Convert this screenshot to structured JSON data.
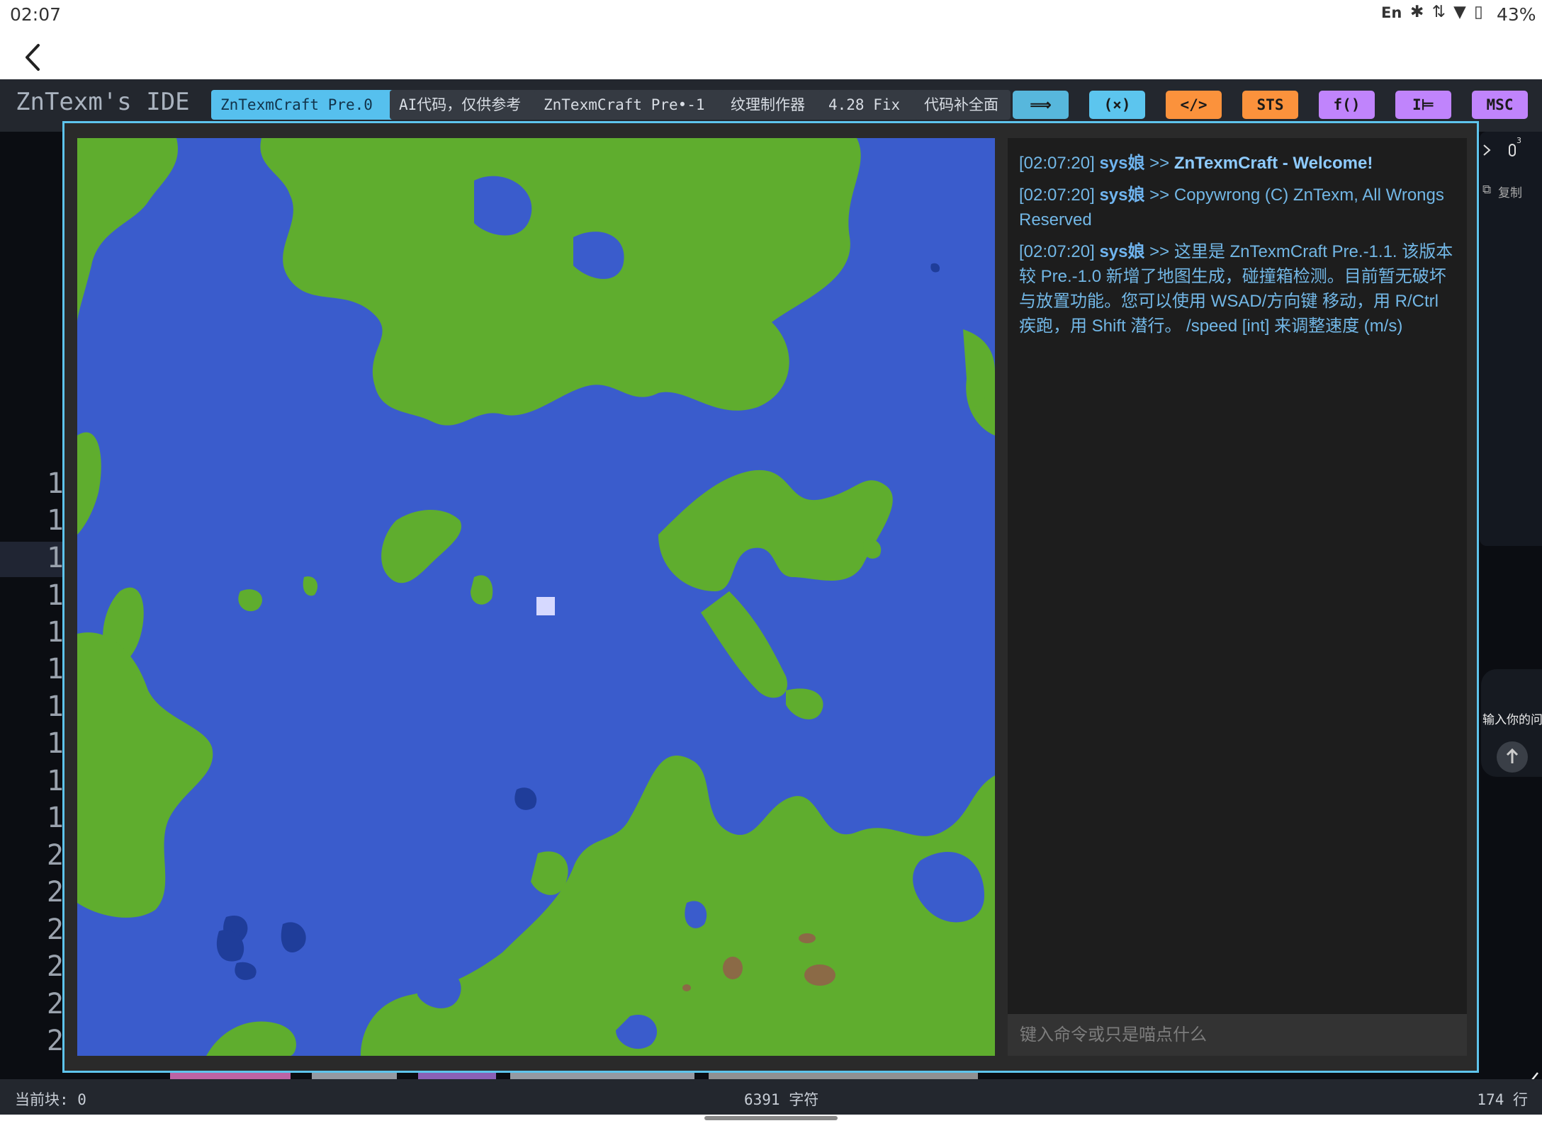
{
  "status_bar": {
    "time": "02:07",
    "lang": "En",
    "icons": "✱ ⇅ ▼ ▯",
    "battery": "43%"
  },
  "ide": {
    "title": "ZnTexm's IDE",
    "tabs": [
      {
        "label": "ZnTexmCraft Pre.0",
        "active": true
      },
      {
        "label": "AI代码，仅供参考",
        "active": false
      },
      {
        "label": "ZnTexmCraft Pre•-1",
        "active": false
      },
      {
        "label": "纹理制作器",
        "active": false
      },
      {
        "label": "4.28 Fix",
        "active": false
      },
      {
        "label": "代码补全面",
        "active": false
      }
    ],
    "tools": [
      {
        "label": "⟹",
        "color": "#57b7dc",
        "icon": "arrow-icon"
      },
      {
        "label": "(×)",
        "color": "#5cc5ee",
        "icon": "variable-icon"
      },
      {
        "label": "</>",
        "color": "#fb923c",
        "icon": "code-icon"
      },
      {
        "label": "STS",
        "color": "#fb923c",
        "icon": "sts-icon"
      },
      {
        "label": "f()",
        "color": "#c084fc",
        "icon": "function-icon"
      },
      {
        "label": "I⊨",
        "color": "#c084fc",
        "icon": "format-icon"
      },
      {
        "label": "MSC",
        "color": "#c084fc",
        "icon": "misc-icon"
      }
    ]
  },
  "editor": {
    "line_numbers": [
      "1",
      "1",
      "1",
      "1",
      "1",
      "1",
      "1",
      "1",
      "1",
      "1",
      "2",
      "2",
      "2",
      "2",
      "2",
      "2"
    ]
  },
  "ai_panel": {
    "copy_label": "复制",
    "input_placeholder": "输入你的问",
    "badge": "3"
  },
  "game": {
    "player_color": "#d6d9ff",
    "colors": {
      "water": "#3a5ccc",
      "deep_water": "#1f3d9a",
      "grass": "#5fad2e",
      "dirt": "#8b6a46"
    },
    "chat": {
      "messages": [
        {
          "time": "[02:07:20]",
          "sender": "sys娘",
          "sep": ">>",
          "text": "ZnTexmCraft - Welcome!",
          "bold": true
        },
        {
          "time": "[02:07:20]",
          "sender": "sys娘",
          "sep": ">>",
          "text": "Copywrong (C) ZnTexm, All Wrongs Reserved",
          "bold": false
        },
        {
          "time": "[02:07:20]",
          "sender": "sys娘",
          "sep": ">>",
          "text": "这里是 ZnTexmCraft Pre.-1.1. 该版本较 Pre.-1.0 新增了地图生成，碰撞箱检测。目前暂无破坏与放置功能。您可以使用 WSAD/方向键 移动，用 R/Ctrl 疾跑，用 Shift 潜行。 /speed [int] 来调整速度 (m/s)",
          "bold": false
        }
      ],
      "input_placeholder": "键入命令或只是喵点什么"
    }
  },
  "footer": {
    "block": "当前块: 0",
    "chars": "6391 字符",
    "lines": "174 行"
  }
}
